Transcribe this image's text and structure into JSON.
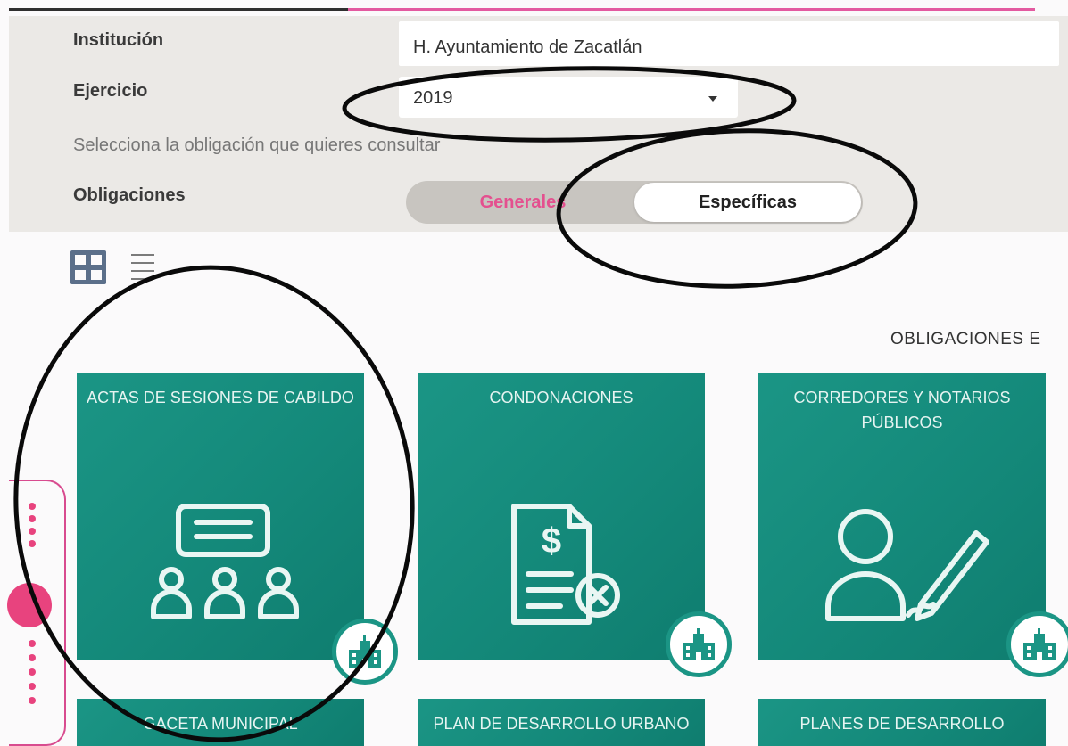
{
  "form": {
    "institucion_label": "Institución",
    "institucion_value": "H. Ayuntamiento de Zacatlán",
    "ejercicio_label": "Ejercicio",
    "ejercicio_value": "2019",
    "hint": "Selecciona la obligación que quieres consultar",
    "obligaciones_label": "Obligaciones",
    "toggle": {
      "generales": "Generales",
      "especificas": "Específicas",
      "selected": "Específicas"
    }
  },
  "view": {
    "grid_icon": "grid-view-icon",
    "list_icon": "list-view-icon"
  },
  "section_title": "OBLIGACIONES E",
  "cards": [
    {
      "title": "ACTAS DE SESIONES DE CABILDO",
      "icon": "meeting-icon"
    },
    {
      "title": "CONDONACIONES",
      "icon": "document-cancel-icon"
    },
    {
      "title": "CORREDORES Y NOTARIOS PÚBLICOS",
      "icon": "person-pen-icon"
    },
    {
      "title": "GACETA MUNICIPAL",
      "icon": ""
    },
    {
      "title": "PLAN DE DESARROLLO URBANO",
      "icon": ""
    },
    {
      "title": "PLANES DE DESARROLLO",
      "icon": ""
    }
  ],
  "colors": {
    "card": "#1b9585",
    "accent_pink": "#e4508f",
    "panel": "#ebe9e6"
  }
}
